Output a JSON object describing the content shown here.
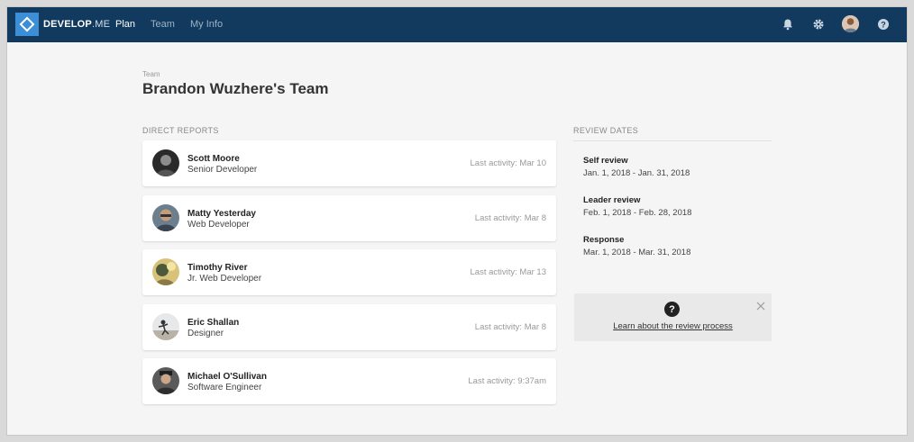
{
  "app": {
    "brand_main": "DEVELOP",
    "brand_suffix": ".ME"
  },
  "nav": {
    "links": [
      {
        "label": "Plan",
        "active": true
      },
      {
        "label": "Team",
        "active": false
      },
      {
        "label": "My Info",
        "active": false
      }
    ],
    "icons": [
      "bell-icon",
      "gear-icon",
      "user-avatar",
      "help-icon"
    ]
  },
  "page": {
    "breadcrumb": "Team",
    "title": "Brandon Wuzhere's Team"
  },
  "direct_reports": {
    "label": "DIRECT REPORTS",
    "items": [
      {
        "name": "Scott Moore",
        "role": "Senior Developer",
        "activity": "Last activity: Mar 10"
      },
      {
        "name": "Matty Yesterday",
        "role": "Web Developer",
        "activity": "Last activity: Mar 8"
      },
      {
        "name": "Timothy River",
        "role": "Jr. Web Developer",
        "activity": "Last activity: Mar 13"
      },
      {
        "name": "Eric Shallan",
        "role": "Designer",
        "activity": "Last activity: Mar 8"
      },
      {
        "name": "Michael O'Sullivan",
        "role": "Software Engineer",
        "activity": "Last activity: 9:37am"
      }
    ]
  },
  "review_dates": {
    "label": "REVIEW DATES",
    "items": [
      {
        "title": "Self review",
        "dates": "Jan. 1, 2018 - Jan. 31, 2018"
      },
      {
        "title": "Leader review",
        "dates": "Feb. 1, 2018 - Feb. 28, 2018"
      },
      {
        "title": "Response",
        "dates": "Mar. 1, 2018 - Mar. 31, 2018"
      }
    ]
  },
  "help": {
    "icon_glyph": "?",
    "link": "Learn about the review process"
  },
  "colors": {
    "nav_bg": "#123a5f",
    "logo_accent": "#3c8fd6",
    "page_bg": "#f5f5f5"
  }
}
